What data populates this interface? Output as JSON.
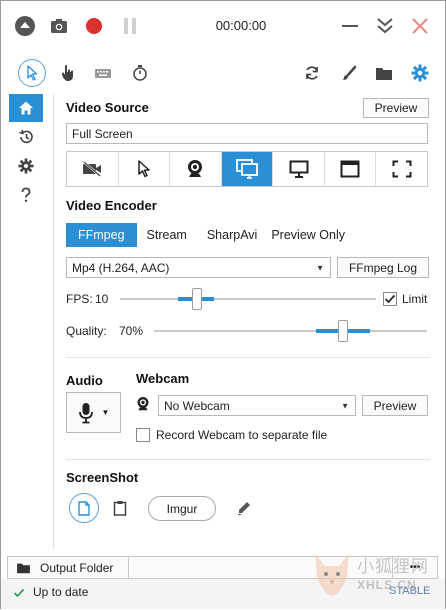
{
  "titlebar": {
    "timer": "00:00:00"
  },
  "colors": {
    "accent": "#2b8fd6",
    "record": "#d9312f",
    "close": "#e98a8a",
    "status_ok": "#2aa05a"
  },
  "video_source": {
    "title": "Video Source",
    "preview_label": "Preview",
    "value": "Full Screen",
    "items": [
      "no-video",
      "region",
      "webcam",
      "screen",
      "full-screen",
      "window",
      "fullscreen-region"
    ],
    "active_index": 3
  },
  "video_encoder": {
    "title": "Video Encoder",
    "tabs": [
      "FFmpeg",
      "Stream",
      "SharpAvi",
      "Preview Only"
    ],
    "active_tab": 0,
    "codec": "Mp4 (H.264, AAC)",
    "log_label": "FFmpeg Log",
    "fps_label": "FPS:",
    "fps_value": "10",
    "limit_label": "Limit",
    "limit_checked": true,
    "quality_label": "Quality:",
    "quality_value": "70%"
  },
  "audio": {
    "title": "Audio"
  },
  "webcam": {
    "title": "Webcam",
    "value": "No Webcam",
    "preview_label": "Preview",
    "separate_label": "Record Webcam to separate file",
    "separate_checked": false
  },
  "screenshot": {
    "title": "ScreenShot",
    "imgur_label": "Imgur"
  },
  "footer": {
    "output_folder": "Output Folder",
    "more": "•••"
  },
  "status": {
    "text": "Up to date",
    "channel": "STABLE"
  },
  "watermark": {
    "cn": "小狐狸网",
    "en": "XHLS.CN"
  }
}
